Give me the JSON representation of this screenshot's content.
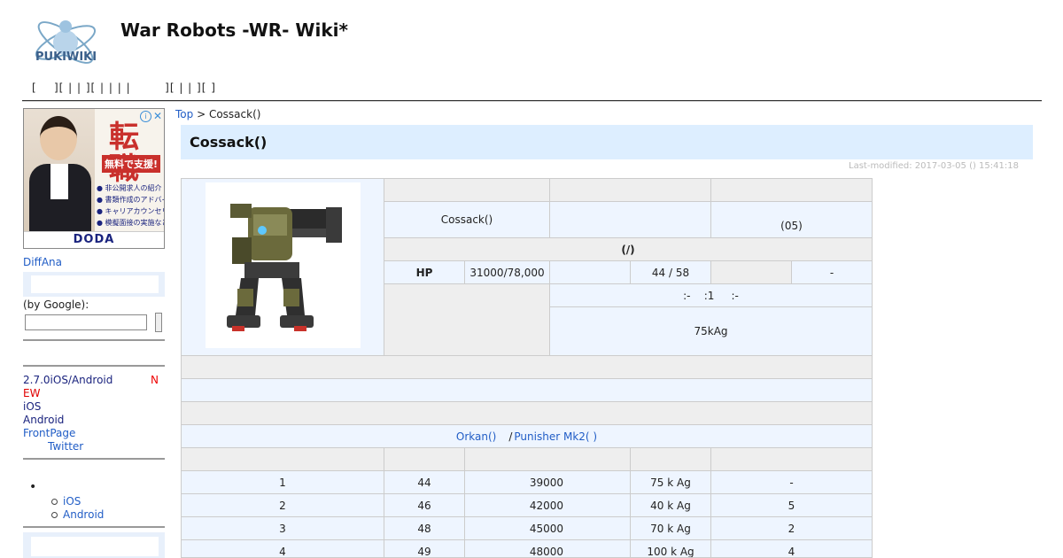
{
  "header": {
    "logo_text": "PUKIWIKI",
    "title": "War Robots -WR-  Wiki*",
    "navbar": "[    ][ | | ][ | | | |        ][ | | ][ ]"
  },
  "ad": {
    "headline": "転職",
    "subhead": "無料で支援!",
    "bullets": [
      "● 非公開求人の紹介",
      "● 書類作成のアドバイス",
      "● キャリアカウンセリング",
      "● 模擬面接の実施など"
    ],
    "brand": "DODA",
    "info_icon": "info-icon",
    "close_icon": "close-icon"
  },
  "sidebar": {
    "diffana": "DiffAna",
    "google_label": "(by Google):",
    "links": [
      {
        "label": "2.7.0iOS/Android",
        "color": "#1a237e"
      },
      {
        "label": "EW",
        "color": "#e00000"
      },
      {
        "label": "iOS",
        "color": "#1a237e"
      },
      {
        "label": "Android",
        "color": "#1a237e"
      },
      {
        "label": "FrontPage",
        "color": "#215dc6"
      },
      {
        "label": "Twitter",
        "color": "#215dc6"
      }
    ],
    "new_badge": "N",
    "sub_items": [
      "iOS",
      "Android"
    ]
  },
  "breadcrumb": {
    "top": "Top",
    "sep": " > ",
    "current": "Cossack()"
  },
  "page": {
    "title": "Cossack()",
    "last_modified": "Last-modified: 2017-03-05 () 15:41:18"
  },
  "spec": {
    "name": "Cossack()",
    "slots": "(05)",
    "section": "(/)",
    "hp_label": "HP",
    "hp_value": "31000/78,000",
    "speed": "44 / 58",
    "dash": "-",
    "hardpoints": ":-    :1     :-",
    "price": "75kAg",
    "alt_text": "/",
    "alt_link1": "Orkan()",
    "alt_link2": "Punisher Mk2( )"
  },
  "levels": {
    "rows": [
      [
        "1",
        "44",
        "39000",
        "75 k Ag",
        "-"
      ],
      [
        "2",
        "46",
        "42000",
        "40 k Ag",
        "5"
      ],
      [
        "3",
        "48",
        "45000",
        "70 k Ag",
        "2"
      ],
      [
        "4",
        "49",
        "48000",
        "100 k Ag",
        "4"
      ]
    ]
  }
}
